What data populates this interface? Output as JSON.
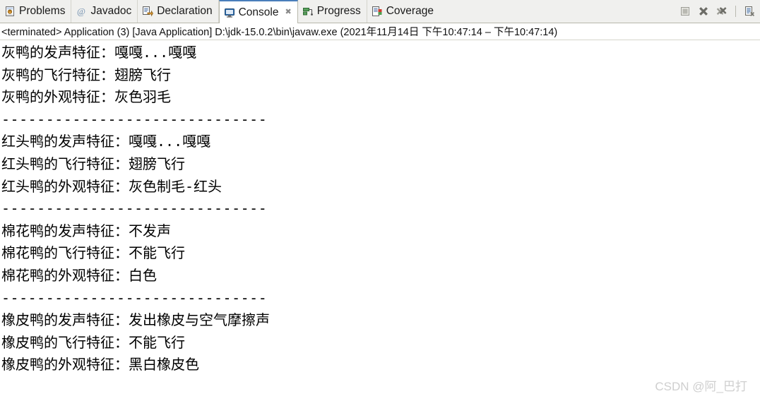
{
  "tabbar": {
    "tabs": [
      {
        "label": "Problems",
        "icon": "problems-icon",
        "active": false,
        "closable": false
      },
      {
        "label": "Javadoc",
        "icon": "javadoc-icon",
        "active": false,
        "closable": false
      },
      {
        "label": "Declaration",
        "icon": "declaration-icon",
        "active": false,
        "closable": false
      },
      {
        "label": "Console",
        "icon": "console-icon",
        "active": true,
        "closable": true
      },
      {
        "label": "Progress",
        "icon": "progress-icon",
        "active": false,
        "closable": false
      },
      {
        "label": "Coverage",
        "icon": "coverage-icon",
        "active": false,
        "closable": false
      }
    ],
    "close_glyph": "✖",
    "toolbar": [
      {
        "name": "terminate-button",
        "icon": "stop-square-icon",
        "enabled": false
      },
      {
        "name": "remove-launch-button",
        "icon": "x-mark-icon",
        "enabled": true
      },
      {
        "name": "remove-all-terminated-button",
        "icon": "double-x-mark-icon",
        "enabled": true
      },
      {
        "name": "clear-console-button",
        "icon": "clear-document-icon",
        "enabled": true
      }
    ]
  },
  "process_header": {
    "text": "<terminated> Application (3) [Java Application] D:\\jdk-15.0.2\\bin\\javaw.exe  (2021年11月14日 下午10:47:14 – 下午10:47:14)"
  },
  "console": {
    "lines": [
      "灰鸭的发声特征：嘎嘎...嘎嘎",
      "灰鸭的飞行特征：翅膀飞行",
      "灰鸭的外观特征：灰色羽毛",
      "------------------------------",
      "红头鸭的发声特征：嘎嘎...嘎嘎",
      "红头鸭的飞行特征：翅膀飞行",
      "红头鸭的外观特征：灰色制毛-红头",
      "------------------------------",
      "棉花鸭的发声特征：不发声",
      "棉花鸭的飞行特征：不能飞行",
      "棉花鸭的外观特征：白色",
      "------------------------------",
      "橡皮鸭的发声特征：发出橡皮与空气摩擦声",
      "橡皮鸭的飞行特征：不能飞行",
      "橡皮鸭的外观特征：黑白橡皮色"
    ]
  },
  "watermark": {
    "text": "CSDN @阿_巴打"
  },
  "colors": {
    "tabbar_bg": "#f0f0ee",
    "active_tab_bg": "#ffffff",
    "active_tab_accent": "#4a7ebb",
    "console_bg": "#ffffff",
    "console_text": "#000000",
    "watermark": "#cfcfcf"
  }
}
